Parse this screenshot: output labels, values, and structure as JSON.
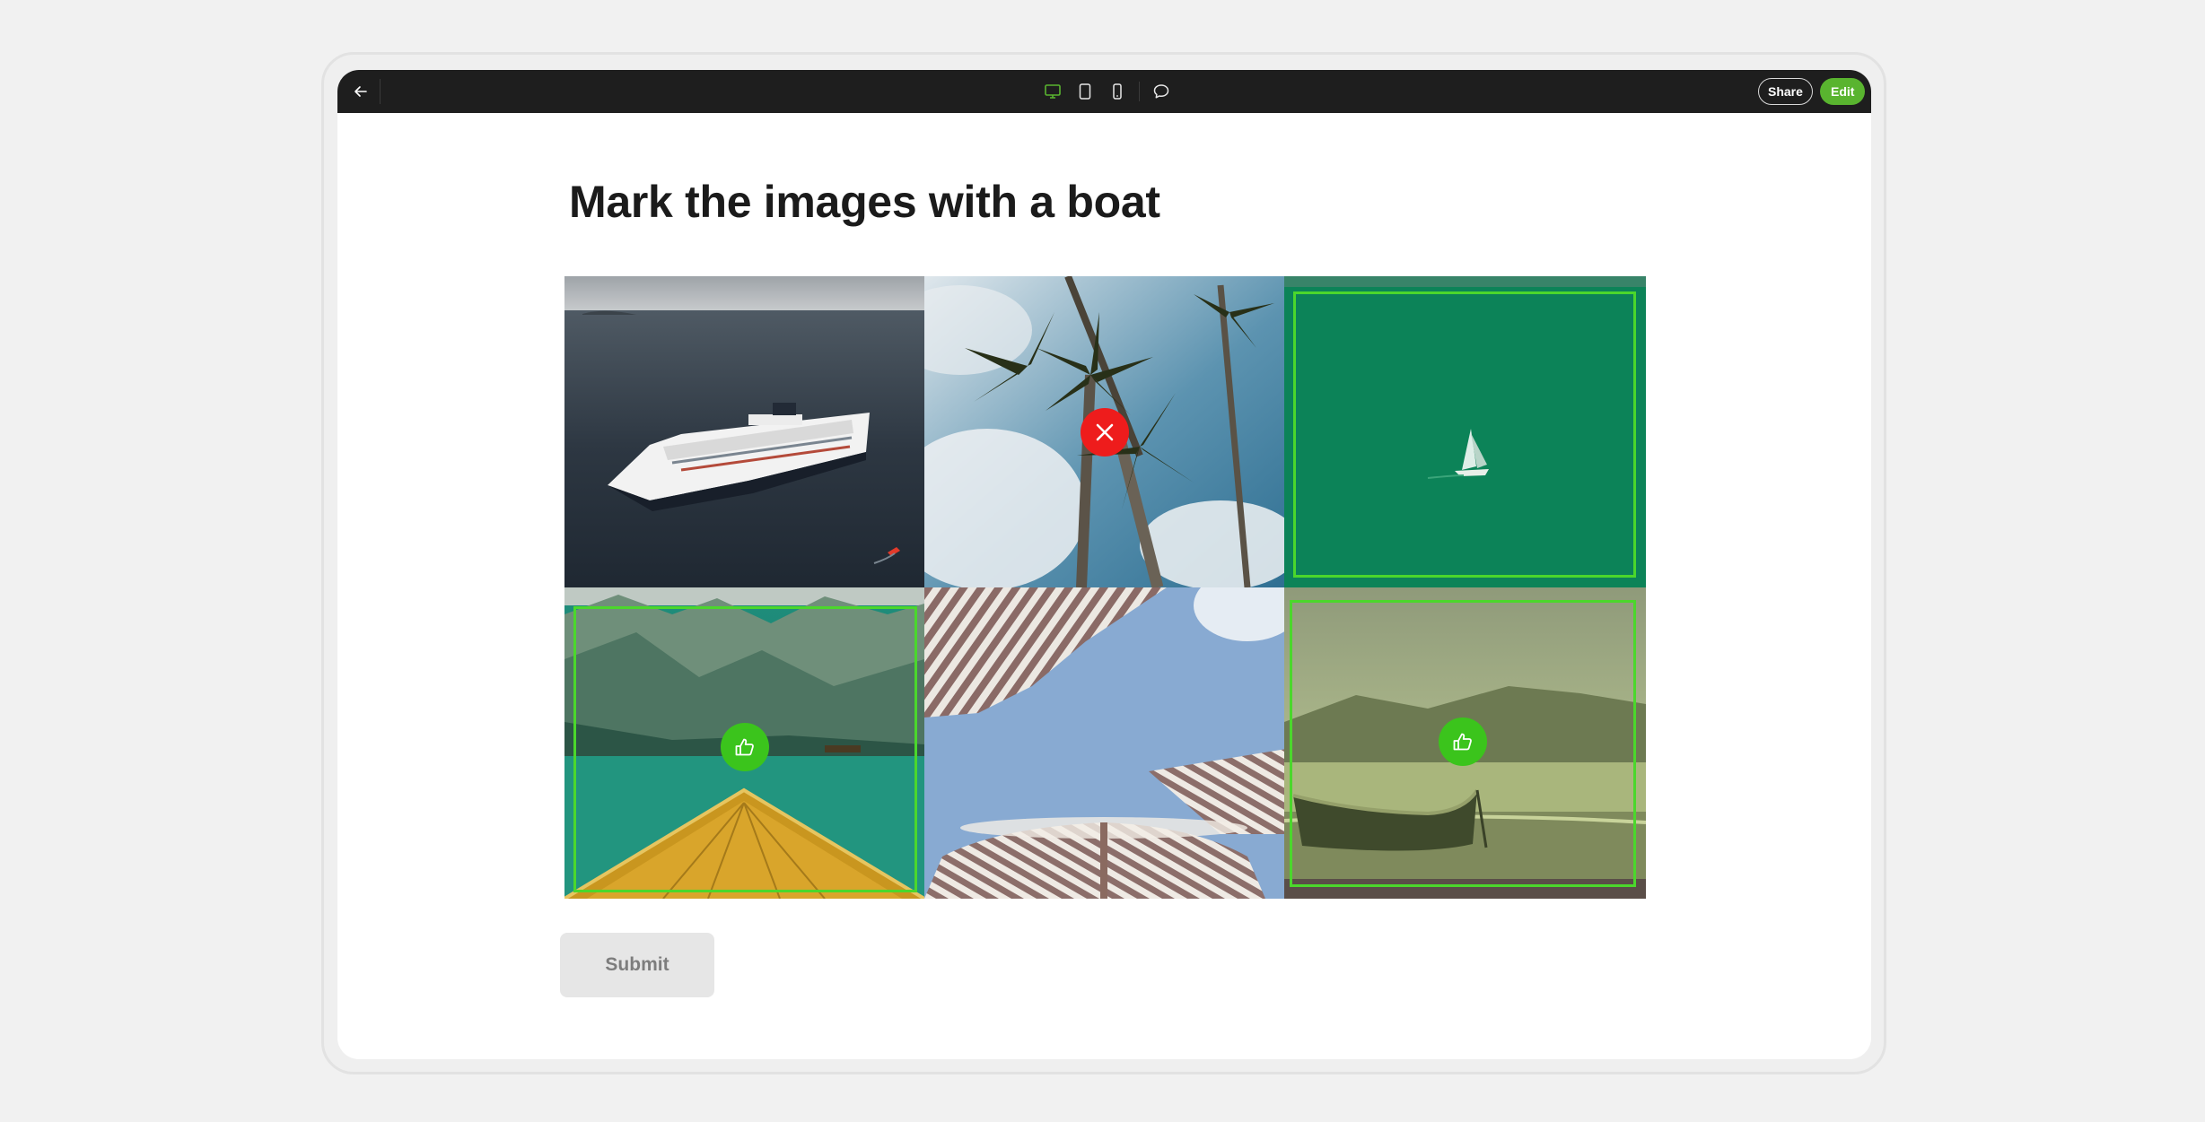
{
  "toolbar": {
    "back_icon": "arrow-left-icon",
    "view_icons": [
      "desktop-icon",
      "tablet-icon",
      "mobile-icon"
    ],
    "comment_icon": "comment-icon",
    "share_label": "Share",
    "edit_label": "Edit",
    "colors": {
      "background": "#1e1e1e",
      "active_icon": "#59b42f",
      "edit_button": "#59b42f"
    }
  },
  "task": {
    "title": "Mark the images with a boat",
    "submit_label": "Submit"
  },
  "tiles": [
    {
      "subject": "cruise ship on dark sea",
      "state": "none"
    },
    {
      "subject": "palm trees against sky",
      "state": "rejected",
      "badge_icon": "close-icon"
    },
    {
      "subject": "small sailboat on green sea",
      "state": "selected"
    },
    {
      "subject": "wooden boat bow on mountain lake",
      "state": "selected",
      "badge_icon": "thumbs-up-icon"
    },
    {
      "subject": "striped beach umbrellas",
      "state": "none"
    },
    {
      "subject": "rowboat on beach at dusk",
      "state": "selected",
      "badge_icon": "thumbs-up-icon"
    }
  ],
  "colors": {
    "selection": "#4bd72c",
    "approve_badge": "#3bc41c",
    "reject_badge": "#ee1c1c"
  }
}
